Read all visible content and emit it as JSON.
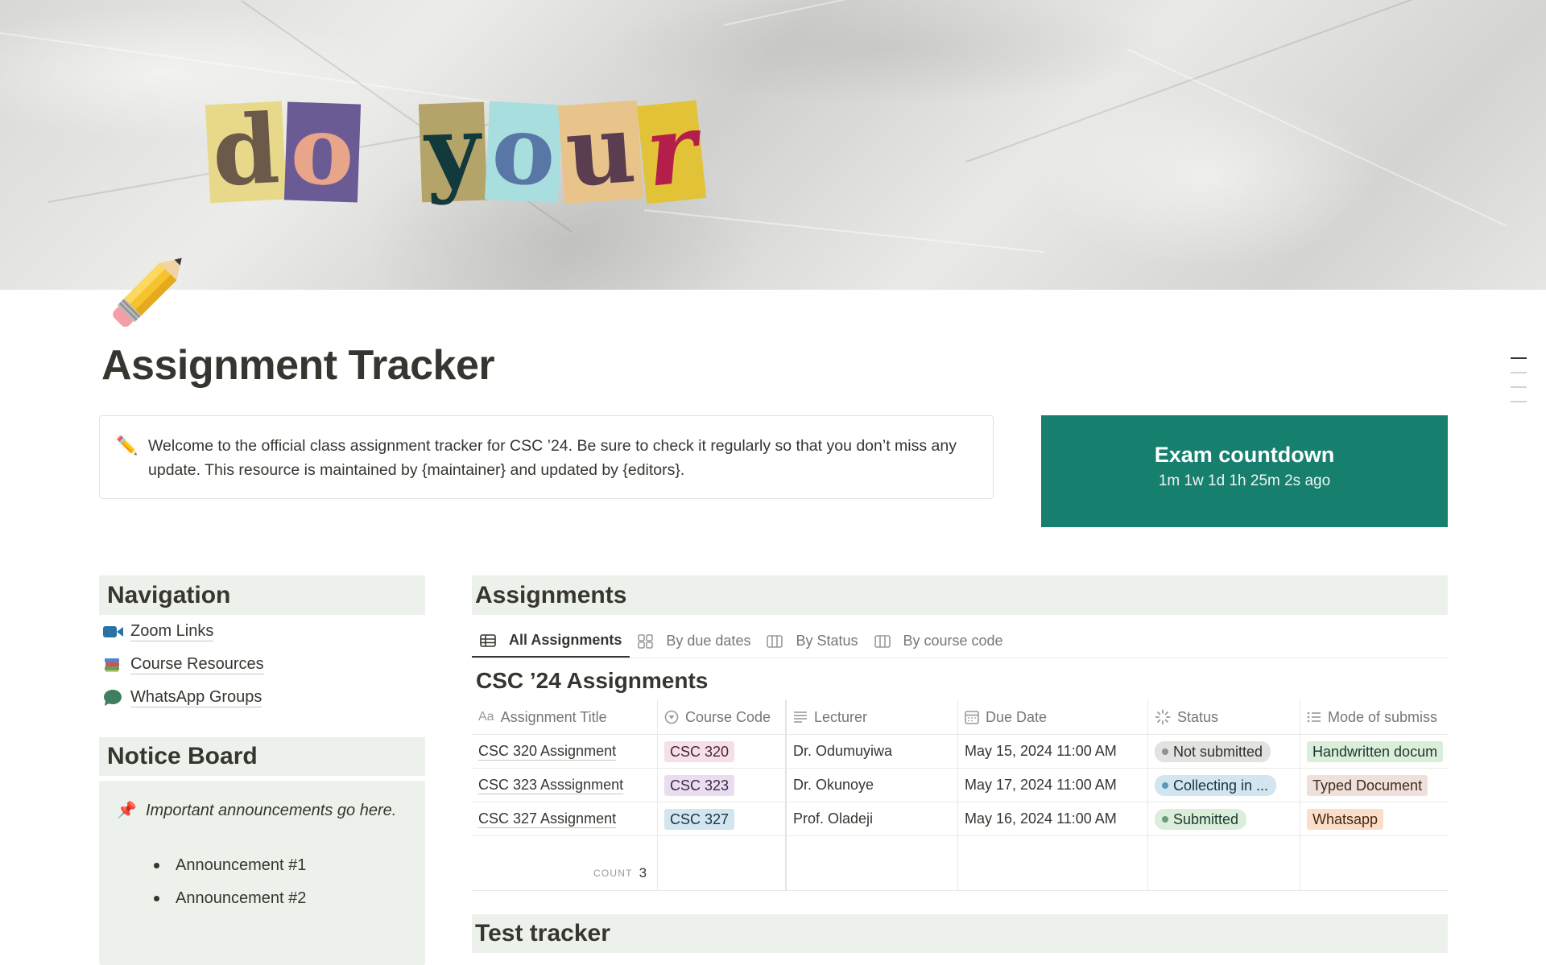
{
  "cover": {
    "word1": [
      "d",
      "o"
    ],
    "word2": [
      "y",
      "o",
      "u",
      "r"
    ]
  },
  "page": {
    "icon": "pencil-icon",
    "title": "Assignment Tracker"
  },
  "callout": {
    "icon": "✏️",
    "text": "Welcome to the official class assignment tracker for CSC ’24. Be sure to check it regularly so that you don’t miss any update. This resource is maintained by {maintainer} and updated by {editors}."
  },
  "countdown": {
    "title": "Exam countdown",
    "value": "1m 1w 1d 1h 25m 2s ago",
    "color": "#177f6e"
  },
  "navigation": {
    "title": "Navigation",
    "items": [
      {
        "label": "Zoom Links",
        "icon": "video-camera-icon"
      },
      {
        "label": "Course Resources",
        "icon": "books-icon"
      },
      {
        "label": "WhatsApp Groups",
        "icon": "speech-bubble-icon"
      }
    ]
  },
  "notice_board": {
    "title": "Notice Board",
    "pin_icon": "📌",
    "text": "Important announcements go here.",
    "bullets": [
      "Announcement #1",
      "Announcement #2"
    ]
  },
  "assignments": {
    "title": "Assignments",
    "tabs": [
      {
        "label": "All Assignments",
        "icon": "table-icon",
        "active": true
      },
      {
        "label": "By due dates",
        "icon": "gallery-icon",
        "active": false
      },
      {
        "label": "By Status",
        "icon": "board-icon",
        "active": false
      },
      {
        "label": "By course code",
        "icon": "board-icon",
        "active": false
      }
    ],
    "database_title": "CSC ’24 Assignments",
    "columns": [
      {
        "label": "Assignment Title",
        "icon": "Aa"
      },
      {
        "label": "Course Code",
        "icon": "select-icon"
      },
      {
        "label": "Lecturer",
        "icon": "text-icon"
      },
      {
        "label": "Due Date",
        "icon": "calendar-icon"
      },
      {
        "label": "Status",
        "icon": "status-icon"
      },
      {
        "label": "Mode of submiss",
        "icon": "list-icon"
      }
    ],
    "rows": [
      {
        "title": "CSC 320 Assignment",
        "course": "CSC 320",
        "lecturer": "Dr. Odumuyiwa",
        "due": "May 15, 2024 11:00 AM",
        "status": "Not submitted",
        "mode": "Handwritten docum"
      },
      {
        "title": "CSC 323 Asssignment",
        "course": "CSC 323",
        "lecturer": "Dr. Okunoye",
        "due": "May 17, 2024 11:00 AM",
        "status": "Collecting in ...",
        "mode": "Typed Document"
      },
      {
        "title": "CSC 327 Assignment",
        "course": "CSC 327",
        "lecturer": "Prof. Oladeji",
        "due": "May 16, 2024 11:00 AM",
        "status": "Submitted",
        "mode": "Whatsapp"
      }
    ],
    "count_label": "COUNT",
    "count_value": "3"
  },
  "test_tracker": {
    "title": "Test tracker"
  },
  "colors": {
    "section_bg": "#edf1ec",
    "tag_pink_bg": "#f5e0e9",
    "tag_pink_fg": "#4c2337",
    "tag_purple_bg": "#e8deee",
    "tag_purple_fg": "#412454",
    "tag_blue_bg": "#d3e5ef",
    "tag_blue_fg": "#183347",
    "status_gray_bg": "#e3e2e0",
    "status_gray_dot": "#91918e",
    "status_blue_bg": "#d3e5ef",
    "status_blue_dot": "#5b97bd",
    "status_green_bg": "#dbeddb",
    "status_green_dot": "#6c9b7d",
    "mode_green_bg": "#dbeddb",
    "mode_brown_bg": "#eee0da",
    "mode_orange_bg": "#fadec9"
  }
}
